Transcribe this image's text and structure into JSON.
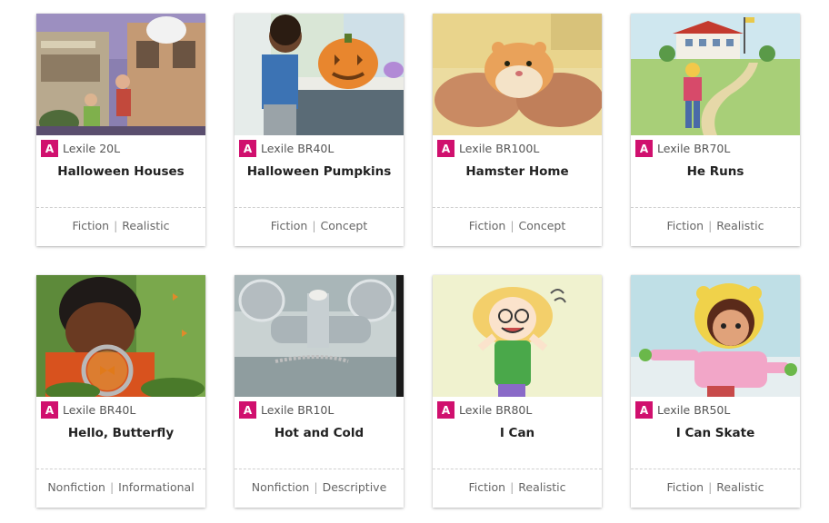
{
  "books": [
    {
      "level": "A",
      "lexile": "Lexile 20L",
      "title": "Halloween Houses",
      "genre": "Fiction",
      "type": "Realistic"
    },
    {
      "level": "A",
      "lexile": "Lexile BR40L",
      "title": "Halloween Pumpkins",
      "genre": "Fiction",
      "type": "Concept"
    },
    {
      "level": "A",
      "lexile": "Lexile BR100L",
      "title": "Hamster Home",
      "genre": "Fiction",
      "type": "Concept"
    },
    {
      "level": "A",
      "lexile": "Lexile BR70L",
      "title": "He Runs",
      "genre": "Fiction",
      "type": "Realistic"
    },
    {
      "level": "A",
      "lexile": "Lexile BR40L",
      "title": "Hello, Butterfly",
      "genre": "Nonfiction",
      "type": "Informational"
    },
    {
      "level": "A",
      "lexile": "Lexile BR10L",
      "title": "Hot and Cold",
      "genre": "Nonfiction",
      "type": "Descriptive"
    },
    {
      "level": "A",
      "lexile": "Lexile BR80L",
      "title": "I Can",
      "genre": "Fiction",
      "type": "Realistic"
    },
    {
      "level": "A",
      "lexile": "Lexile BR50L",
      "title": "I Can Skate",
      "genre": "Fiction",
      "type": "Realistic"
    }
  ],
  "colors": {
    "level_badge": "#d0106e"
  }
}
